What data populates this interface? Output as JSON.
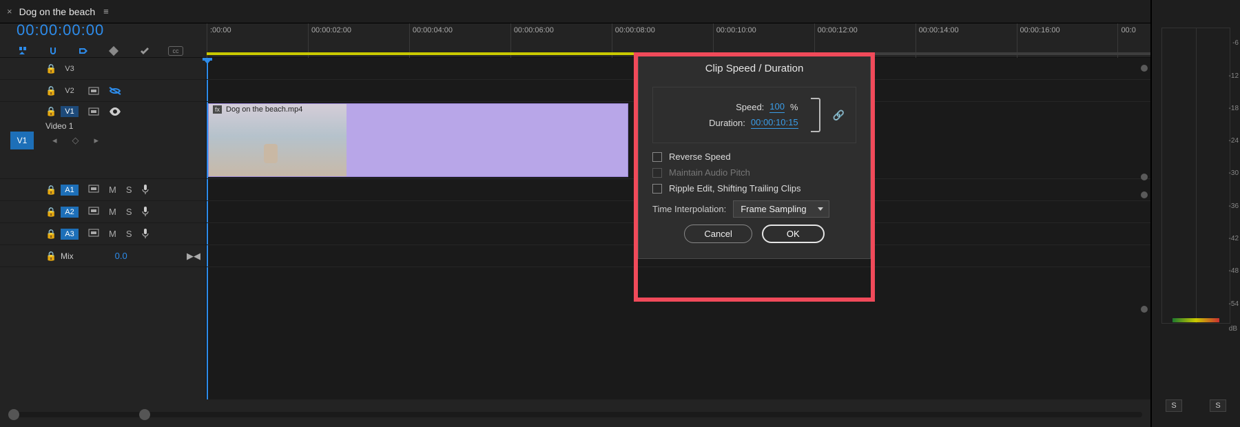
{
  "tab": {
    "title": "Dog on the beach"
  },
  "playhead": {
    "timecode": "00:00:00:00"
  },
  "ruler": {
    "ticks": [
      ":00:00",
      "00:00:02:00",
      "00:00:04:00",
      "00:00:06:00",
      "00:00:08:00",
      "00:00:10:00",
      "00:00:12:00",
      "00:00:14:00",
      "00:00:16:00",
      "00:0"
    ]
  },
  "tracks": {
    "video": [
      {
        "src": "",
        "label": "V3"
      },
      {
        "src": "",
        "label": "V2"
      },
      {
        "src": "V1",
        "label": "V1",
        "name": "Video 1"
      }
    ],
    "audio": [
      {
        "src": "",
        "label": "A1",
        "mute": "M",
        "solo": "S"
      },
      {
        "src": "",
        "label": "A2",
        "mute": "M",
        "solo": "S"
      },
      {
        "src": "",
        "label": "A3",
        "mute": "M",
        "solo": "S"
      }
    ],
    "mix": {
      "label": "Mix",
      "value": "0.0"
    }
  },
  "clip": {
    "filename": "Dog on the beach.mp4",
    "fx": "fx"
  },
  "dialog": {
    "title": "Clip Speed / Duration",
    "speed_label": "Speed:",
    "speed_value": "100",
    "speed_unit": "%",
    "duration_label": "Duration:",
    "duration_value": "00:00:10:15",
    "reverse_label": "Reverse Speed",
    "pitch_label": "Maintain Audio Pitch",
    "ripple_label": "Ripple Edit, Shifting Trailing Clips",
    "interp_label": "Time Interpolation:",
    "interp_value": "Frame Sampling",
    "cancel": "Cancel",
    "ok": "OK"
  },
  "meter": {
    "scale": [
      "-6",
      "-12",
      "-18",
      "-24",
      "-30",
      "-36",
      "-42",
      "-48",
      "-54"
    ],
    "db": "dB",
    "solo": "S"
  }
}
